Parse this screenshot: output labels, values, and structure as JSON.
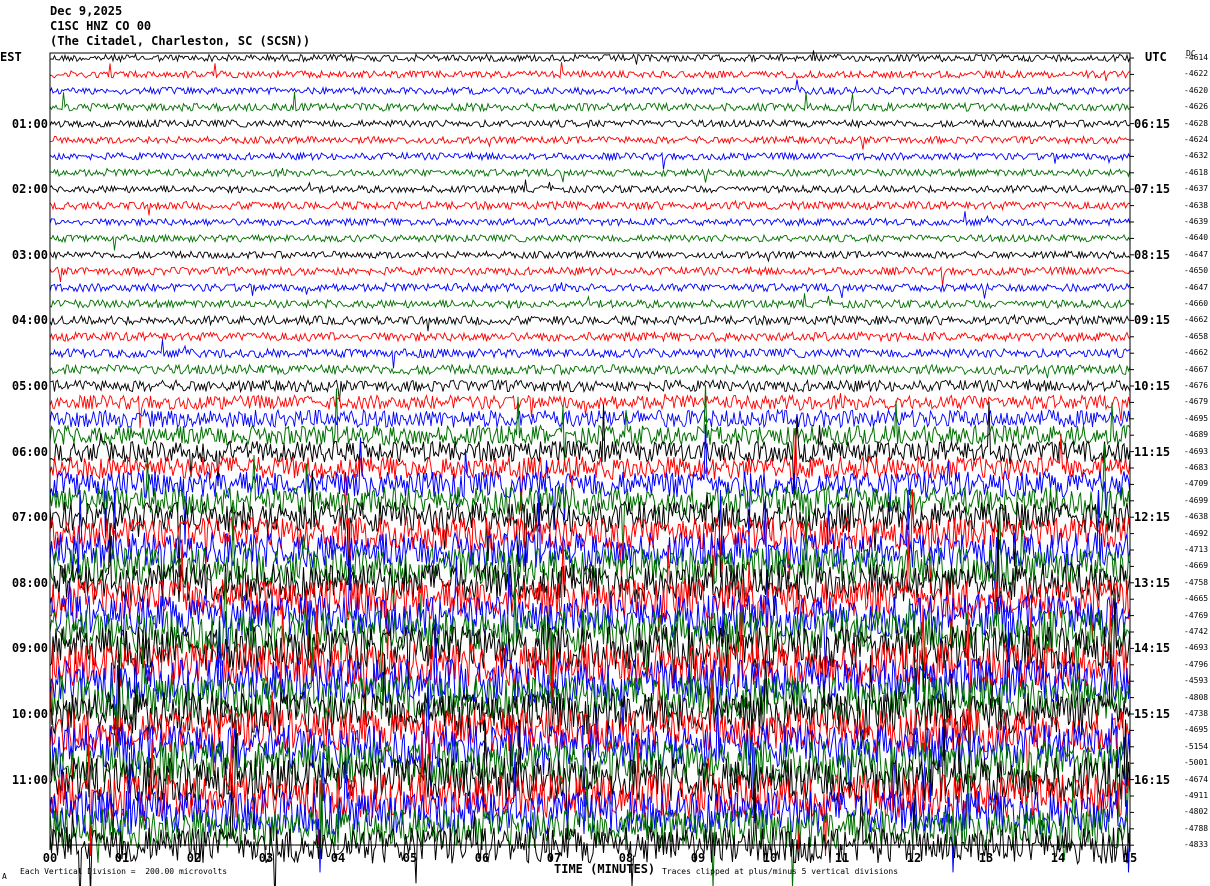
{
  "header": {
    "date": "Dec 9,2025",
    "station": "C1SC HNZ CO 00",
    "location": "(The Citadel, Charleston, SC (SCSN))"
  },
  "axes": {
    "left_zone": "EST",
    "right_zone": "UTC",
    "dc_header": "DC",
    "x_title": "TIME (MINUTES)"
  },
  "footer": {
    "scale_note": "Each Vertical Division =  200.00 microvolts",
    "clip_note": "Traces clipped at plus/minus 5 vertical divisions",
    "corner_mark": "A"
  },
  "colors": {
    "trace_cycle": [
      "#000000",
      "#ff0000",
      "#0000ff",
      "#007000"
    ]
  },
  "chart_data": {
    "type": "line",
    "title": "C1SC HNZ CO 00",
    "xlabel": "TIME (MINUTES)",
    "xlim": [
      0,
      15
    ],
    "x_ticks": [
      "00",
      "01",
      "02",
      "03",
      "04",
      "05",
      "06",
      "07",
      "08",
      "09",
      "10",
      "11",
      "12",
      "13",
      "14",
      "15"
    ],
    "rows_per_hour": 4,
    "est_hour_labels": [
      "01:00",
      "02:00",
      "03:00",
      "04:00",
      "05:00",
      "06:00",
      "07:00",
      "08:00",
      "09:00",
      "10:00",
      "11:00"
    ],
    "utc_hour_labels": [
      "06:15",
      "07:15",
      "08:15",
      "09:15",
      "10:15",
      "11:15",
      "12:15",
      "13:15",
      "14:15",
      "15:15",
      "16:15"
    ],
    "dc_offsets": [
      "-4614",
      "-4622",
      "-4620",
      "-4626",
      "-4628",
      "-4624",
      "-4632",
      "-4618",
      "-4637",
      "-4638",
      "-4639",
      "-4640",
      "-4647",
      "-4650",
      "-4647",
      "-4660",
      "-4662",
      "-4658",
      "-4662",
      "-4667",
      "-4676",
      "-4679",
      "-4695",
      "-4689",
      "-4693",
      "-4683",
      "-4709",
      "-4699",
      "-4638",
      "-4692",
      "-4713",
      "-4669",
      "-4758",
      "-4665",
      "-4769",
      "-4742",
      "-4693",
      "-4796",
      "-4593",
      "-4808",
      "-4738",
      "-4695",
      "-5154",
      "-5001",
      "-4674",
      "-4911",
      "-4802",
      "-4788",
      "-4833"
    ],
    "amplitude_profile_divisions": [
      0.8,
      0.8,
      0.8,
      0.9,
      0.8,
      0.8,
      0.8,
      0.8,
      0.8,
      0.9,
      0.8,
      0.8,
      0.8,
      0.9,
      0.9,
      0.9,
      1.0,
      1.0,
      1.0,
      1.1,
      1.3,
      1.6,
      2.0,
      2.2,
      2.4,
      2.6,
      3.0,
      3.2,
      3.5,
      3.7,
      4.0,
      4.2,
      4.4,
      4.6,
      4.8,
      5.0,
      5.0,
      5.0,
      5.0,
      5.0,
      5.0,
      5.0,
      5.0,
      5.0,
      5.0,
      5.0,
      5.0,
      4.5,
      4.2
    ],
    "scale_microvolts_per_division": 200.0,
    "clip_divisions": 5
  }
}
